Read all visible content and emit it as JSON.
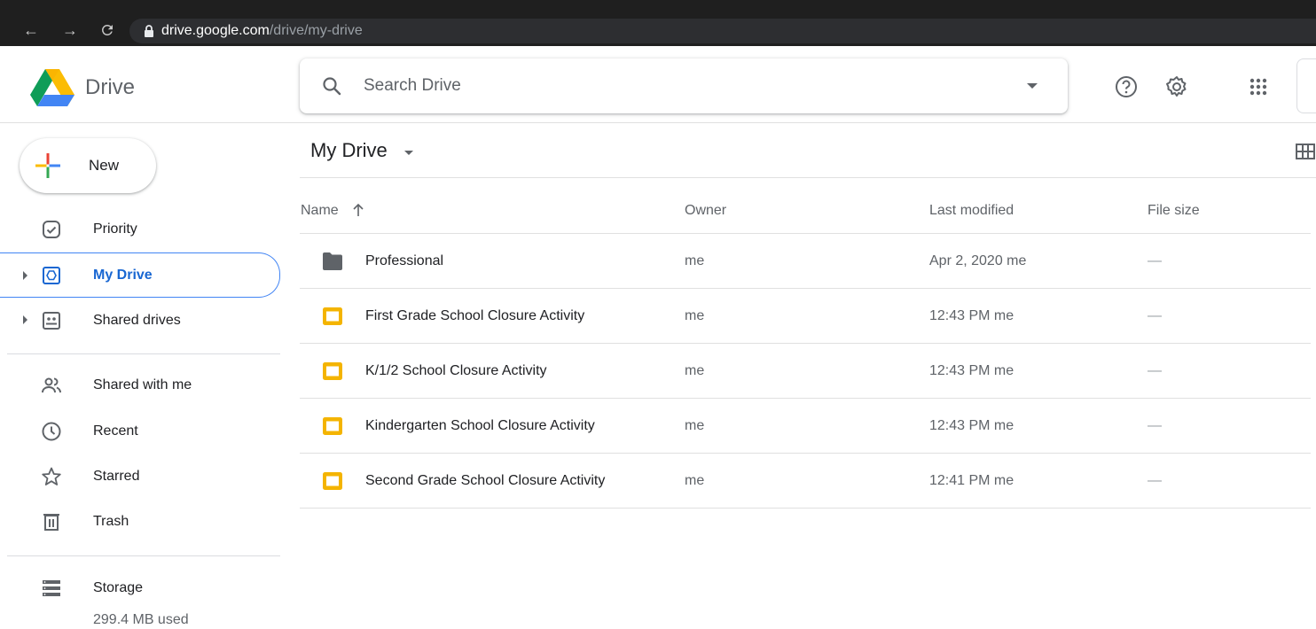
{
  "browser": {
    "url_host": "drive.google.com",
    "url_path": "/drive/my-drive",
    "back_icon": "arrow-left-icon",
    "forward_icon": "arrow-right-icon",
    "reload_icon": "reload-icon",
    "lock_icon": "lock-icon"
  },
  "header": {
    "app_name": "Drive",
    "search_placeholder": "Search Drive",
    "icons": [
      "help-icon",
      "settings-icon",
      "apps-icon"
    ]
  },
  "sidebar": {
    "new_label": "New",
    "items": [
      {
        "label": "Priority",
        "icon": "priority-icon"
      },
      {
        "label": "My Drive",
        "icon": "my-drive-icon",
        "active": true
      },
      {
        "label": "Shared drives",
        "icon": "shared-drives-icon"
      },
      {
        "label": "Shared with me",
        "icon": "people-icon"
      },
      {
        "label": "Recent",
        "icon": "clock-icon"
      },
      {
        "label": "Starred",
        "icon": "star-icon"
      },
      {
        "label": "Trash",
        "icon": "trash-icon"
      },
      {
        "label": "Storage",
        "icon": "storage-icon"
      }
    ],
    "storage_used": "299.4 MB used"
  },
  "main": {
    "title": "My Drive",
    "columns": {
      "name": "Name",
      "owner": "Owner",
      "modified": "Last modified",
      "size": "File size"
    },
    "files": [
      {
        "name": "Professional",
        "type": "folder",
        "owner": "me",
        "modified": "Apr 2, 2020 me",
        "size": "—"
      },
      {
        "name": "First Grade School Closure Activity",
        "type": "slides",
        "owner": "me",
        "modified": "12:43 PM me",
        "size": "—"
      },
      {
        "name": "K/1/2 School Closure Activity",
        "type": "slides",
        "owner": "me",
        "modified": "12:43 PM me",
        "size": "—"
      },
      {
        "name": "Kindergarten School Closure Activity",
        "type": "slides",
        "owner": "me",
        "modified": "12:43 PM me",
        "size": "—"
      },
      {
        "name": "Second Grade School Closure Activity",
        "type": "slides",
        "owner": "me",
        "modified": "12:41 PM me",
        "size": "—"
      }
    ]
  },
  "colors": {
    "accent": "#1967d2",
    "slides": "#f4b400",
    "folder": "#5f6368"
  }
}
